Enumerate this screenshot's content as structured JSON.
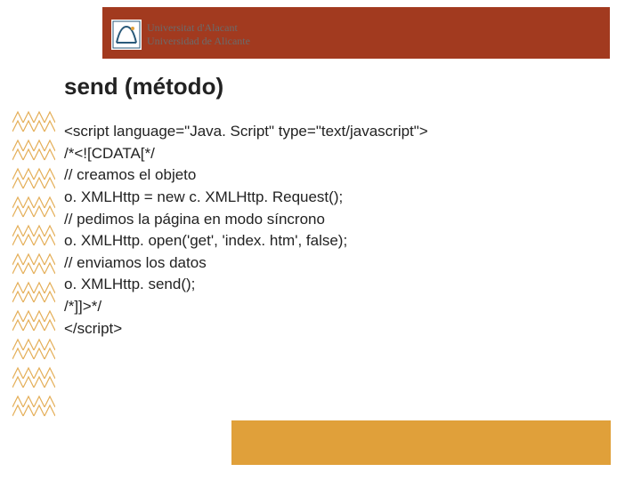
{
  "logo": {
    "line1": "Universitat d'Alacant",
    "line2": "Universidad de Alicante"
  },
  "title": "send (método)",
  "code": {
    "l0": "<script language=\"Java. Script\" type=\"text/javascript\">",
    "l1": "/*<![CDATA[*/",
    "l2": " // creamos el objeto",
    "l3": "  o. XMLHttp = new c. XMLHttp. Request();",
    "l4": "  // pedimos la página en modo síncrono",
    "l5": "  o. XMLHttp. open('get', 'index. htm', false);",
    "l6": "  // enviamos los datos",
    "l7": "  o. XMLHttp. send();",
    "l8": "/*]]>*/",
    "l9": "</script>"
  }
}
